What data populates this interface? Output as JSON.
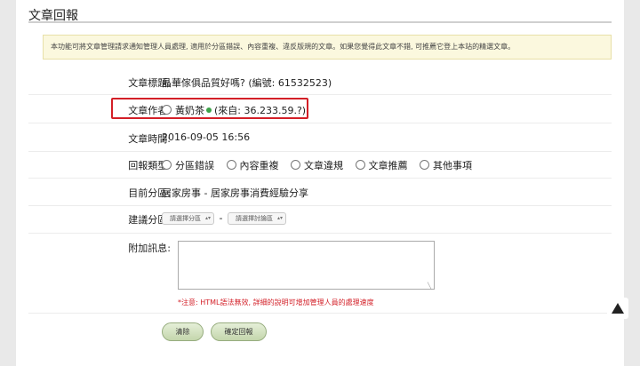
{
  "header": {
    "title": "文章回報"
  },
  "notice": "本功能可將文章管理請求通知管理人員處理, 適用於分區錯誤、內容重複、違反版規的文章。如果您覺得此文章不錯, 可推薦它登上本站的精選文章。",
  "fields": {
    "title_label": "文章標題:",
    "title_value": "晶華傢俱品質好嗎? (編號: 61532523)",
    "author_label": "文章作者:",
    "author_name": "黃奶茶",
    "author_ip": "(來自: 36.233.59.?)",
    "time_label": "文章時間:",
    "time_value": "2016-09-05 16:56",
    "type_label": "回報類型:",
    "type_options": [
      "分區錯誤",
      "內容重複",
      "文章違規",
      "文章推薦",
      "其他事項"
    ],
    "zone_label": "目前分區:",
    "zone_value": "居家房事 - 居家房事消費經驗分享",
    "suggest_label": "建議分區:",
    "select_zone": "請選擇分區",
    "select_forum": "請選擇討論區",
    "select_sep": "-",
    "extra_label": "附加訊息:",
    "textarea_value": "",
    "hint": "*注意: HTML語法無效, 詳細的說明可增加管理人員的處理速度"
  },
  "buttons": {
    "clear": "清除",
    "submit": "確定回報"
  },
  "colors": {
    "highlight": "#d31f27",
    "button": "#c4d6ac",
    "notice_bg": "#fbf8de",
    "online_dot": "#3da34a"
  },
  "icons": {
    "scroll_top": "triangle-up-icon",
    "online": "online-dot-icon",
    "radio": "radio-icon"
  }
}
